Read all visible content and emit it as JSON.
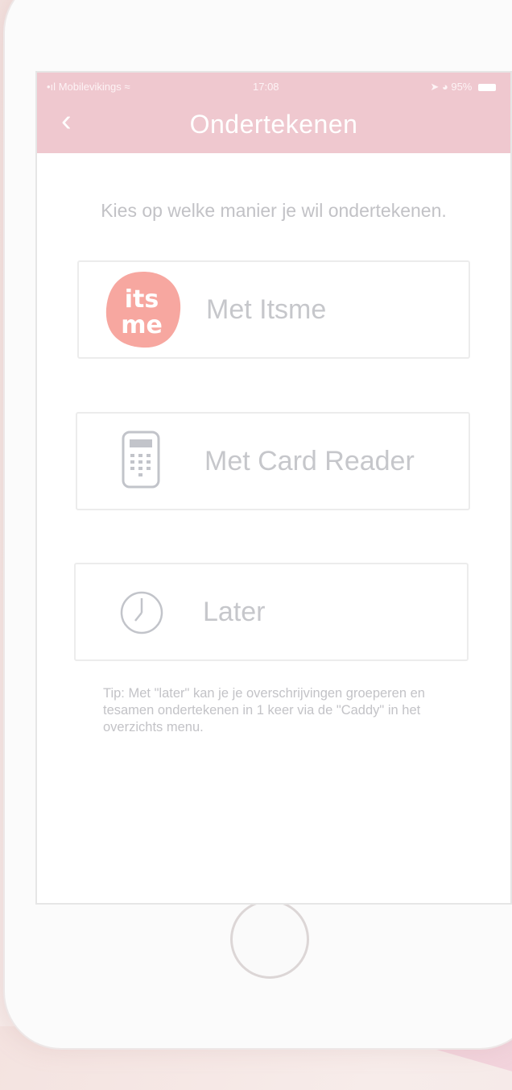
{
  "statusbar": {
    "carrier": "Mobilevikings",
    "time": "17:08",
    "battery": "95%"
  },
  "header": {
    "back_label": "‹",
    "title": "Ondertekenen"
  },
  "intro": "Kies op welke manier je wil ondertekenen.",
  "options": [
    {
      "label": "Met Itsme",
      "icon": "itsme-logo",
      "logo_text": "its\nme",
      "color": "#f7a7a0"
    },
    {
      "label": "Met Card Reader",
      "icon": "card-reader-icon"
    },
    {
      "label": "Later",
      "icon": "clock-icon"
    }
  ],
  "tip": "Tip: Met \"later\" kan je je overschrijvingen groeperen en tesamen ondertekenen in 1 keer via de \"Caddy\" in het overzichts menu.",
  "colors": {
    "header": "#efc8cf",
    "text_muted": "#c3c3c7",
    "itsme": "#f7a7a0"
  }
}
